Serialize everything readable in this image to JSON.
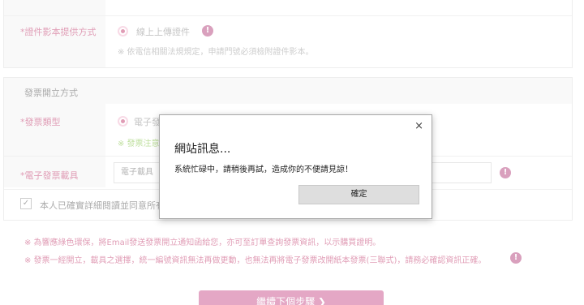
{
  "form": {
    "id_image_row": {
      "label": "證件影本提供方式",
      "required_mark": "*",
      "option_label": "線上上傳證件",
      "hint": "※ 依電信相關法規規定，申請門號必須檢附證件影本。"
    },
    "invoice_section": {
      "title": "發票開立方式",
      "type_row": {
        "label": "發票類型",
        "required_mark": "*",
        "option_label": "電子發票",
        "hint": "※ 發票注意事項"
      },
      "carrier_row": {
        "label": "電子發票載具",
        "required_mark": "*",
        "select_value": "電子載具"
      },
      "agree_row": {
        "label": "本人已確實詳細閱讀並同意所有"
      }
    },
    "notes": [
      "※ 為響應綠色環保，將Email發送發票開立通知函給您，亦可至訂單查詢發票資訊，以示購買證明。",
      "※ 發票一經開立，載具之選擇，統一編號資訊無法再做更動，也無法再將電子發票改開紙本發票(三聯式)，請務必確認資訊正確。"
    ],
    "next_button": "繼續下個步驟 ❯"
  },
  "dialog": {
    "close_glyph": "×",
    "title": "網站訊息...",
    "message": "系統忙碌中，請稍後再試，造成你的不便請見諒！",
    "confirm_label": "確定"
  },
  "icons": {
    "info": "!",
    "check": "✓"
  },
  "colors": {
    "accent": "#c0396b",
    "info_icon": "#b2407a",
    "hint_green": "#7cbf3a",
    "button": "#c84f8a"
  }
}
